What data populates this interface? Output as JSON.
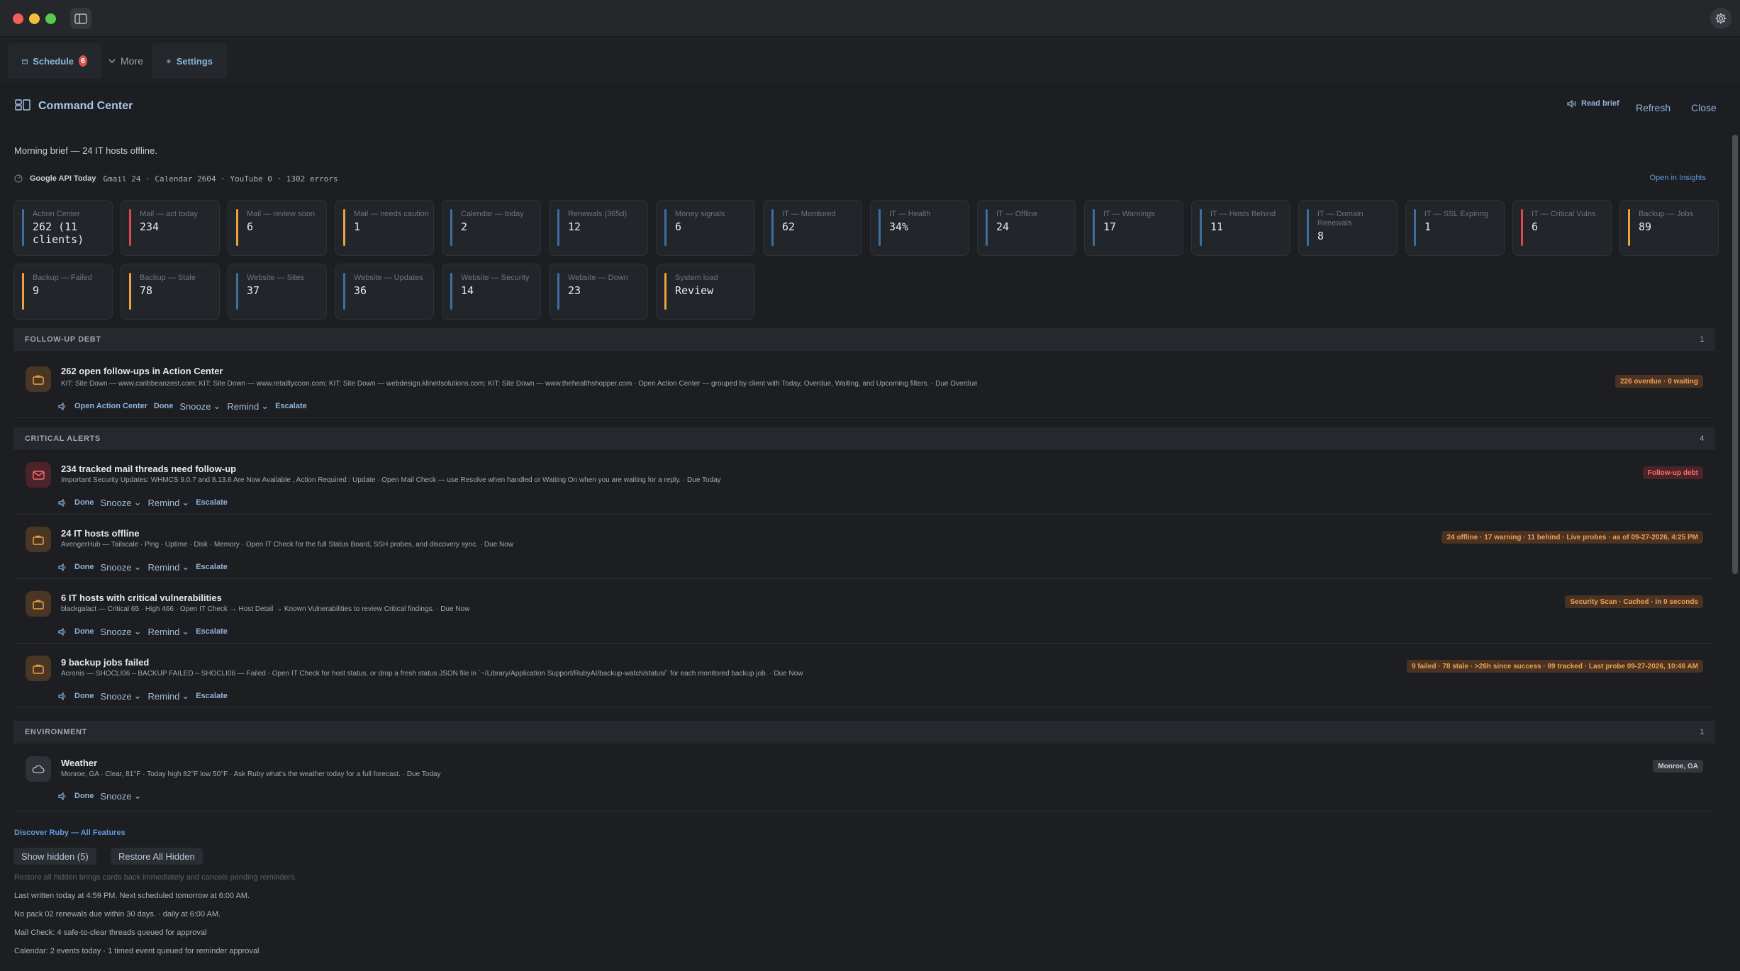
{
  "tabs": {
    "schedule_label": "Schedule",
    "schedule_badge": "6",
    "more_label": "More",
    "settings_label": "Settings"
  },
  "header": {
    "title": "Command Center",
    "read_brief": "Read brief",
    "refresh": "Refresh",
    "close": "Close"
  },
  "brief": "Morning brief — 24 IT hosts offline.",
  "google": {
    "label": "Google API Today",
    "stats": "Gmail 24 · Calendar 2604 · YouTube 0 · 1302 errors",
    "open_insights": "Open in Insights"
  },
  "tiles": [
    {
      "label": "Action Center",
      "value": "262 (11 clients)",
      "color": "#3f6f9e"
    },
    {
      "label": "Mail — act today",
      "value": "234",
      "color": "#e0464a"
    },
    {
      "label": "Mail — review soon",
      "value": "6",
      "color": "#f0a03c"
    },
    {
      "label": "Mail — needs caution",
      "value": "1",
      "color": "#f0a03c"
    },
    {
      "label": "Calendar — today",
      "value": "2",
      "color": "#3f6f9e"
    },
    {
      "label": "Renewals (365d)",
      "value": "12",
      "color": "#3f6f9e"
    },
    {
      "label": "Money signals",
      "value": "6",
      "color": "#3f6f9e"
    },
    {
      "label": "IT — Monitored",
      "value": "62",
      "color": "#3f6f9e"
    },
    {
      "label": "IT — Health",
      "value": "34%",
      "color": "#3f6f9e"
    },
    {
      "label": "IT — Offline",
      "value": "24",
      "color": "#3f6f9e"
    },
    {
      "label": "IT — Warnings",
      "value": "17",
      "color": "#3f6f9e"
    },
    {
      "label": "IT — Hosts Behind",
      "value": "11",
      "color": "#3f6f9e"
    },
    {
      "label": "IT — Domain Renewals",
      "value": "8",
      "color": "#3f6f9e"
    },
    {
      "label": "IT — SSL Expiring",
      "value": "1",
      "color": "#3f6f9e"
    },
    {
      "label": "IT — Critical Vulns",
      "value": "6",
      "color": "#e0464a"
    },
    {
      "label": "Backup — Jobs",
      "value": "89",
      "color": "#f0a03c"
    },
    {
      "label": "Backup — Failed",
      "value": "9",
      "color": "#f0a03c"
    },
    {
      "label": "Backup — Stale",
      "value": "78",
      "color": "#f0a03c"
    },
    {
      "label": "Website — Sites",
      "value": "37",
      "color": "#3f6f9e"
    },
    {
      "label": "Website — Updates",
      "value": "36",
      "color": "#3f6f9e"
    },
    {
      "label": "Website — Security",
      "value": "14",
      "color": "#3f6f9e"
    },
    {
      "label": "Website — Down",
      "value": "23",
      "color": "#3f6f9e"
    },
    {
      "label": "System load",
      "value": "Review",
      "color": "#f0a03c"
    }
  ],
  "sections": {
    "followup": {
      "title": "FOLLOW-UP DEBT",
      "count": "1",
      "item": {
        "title": "262 open follow-ups in Action Center",
        "desc": "KIT: Site Down — www.caribbeanzest.com; KIT: Site Down — www.retailtycoon.com; KIT: Site Down — webdesign.klineitsolutions.com; KIT: Site Down — www.thehealthshopper.com · Open Action Center — grouped by client with Today, Overdue, Waiting, and Upcoming filters. · Due Overdue",
        "pill": "226 overdue · 0 waiting",
        "open_action": "Open Action Center"
      }
    },
    "critical": {
      "title": "CRITICAL ALERTS",
      "count": "4",
      "items": [
        {
          "title": "234 tracked mail threads need follow-up",
          "desc": "Important Security Updates: WHMCS 9.0.7 and 8.13.6 Are Now Available , Action Required : Update · Open Mail Check — use Resolve when handled or Waiting On when you are waiting for a reply. · Due Today",
          "pill": "Follow-up debt"
        },
        {
          "title": "24 IT hosts offline",
          "desc": "AvengerHub — Tailscale · Ping · Uptime · Disk · Memory · Open IT Check for the full Status Board, SSH probes, and discovery sync. · Due Now",
          "pill": "24 offline · 17 warning · 11 behind · Live probes · as of 09-27-2026, 4:25 PM"
        },
        {
          "title": "6 IT hosts with critical vulnerabilities",
          "desc": "blackgalact — Critical 65 · High 466 · Open IT Check → Host Detail → Known Vulnerabilities to review Critical findings. · Due Now",
          "pill": "Security Scan · Cached · in 0 seconds"
        },
        {
          "title": "9 backup jobs failed",
          "desc": "Acronis — SHOCLI06 – BACKUP FAILED – SHOCLI06 — Failed · Open IT Check for host status, or drop a fresh status JSON file in `~/Library/Application Support/RubyAI/backup-watch/status/` for each monitored backup job. · Due Now",
          "pill": "9 failed · 78 stale · >26h since success · 89 tracked · Last probe 09-27-2026, 10:46 AM"
        }
      ]
    },
    "environment": {
      "title": "ENVIRONMENT",
      "count": "1",
      "item": {
        "title": "Weather",
        "desc": "Monroe, GA · Clear, 81°F · Today high 82°F low 50°F · Ask Ruby what's the weather today for a full forecast. · Due Today",
        "pill": "Monroe, GA"
      }
    }
  },
  "actions": {
    "done": "Done",
    "snooze": "Snooze",
    "remind": "Remind",
    "escalate": "Escalate"
  },
  "footer": {
    "discover": "Discover Ruby — All Features",
    "show_hidden": "Show hidden (5)",
    "restore_all": "Restore All Hidden",
    "restore_note": "Restore all hidden brings cards back immediately and cancels pending reminders.",
    "last_written": "Last written today at 4:59 PM. Next scheduled tomorrow at 6:00 AM.",
    "renewals": "No pack 02 renewals due within 30 days. · daily at 6:00 AM.",
    "mail_check": "Mail Check: 4 safe-to-clear threads queued for approval",
    "calendar": "Calendar: 2 events today · 1 timed event queued for reminder approval"
  }
}
